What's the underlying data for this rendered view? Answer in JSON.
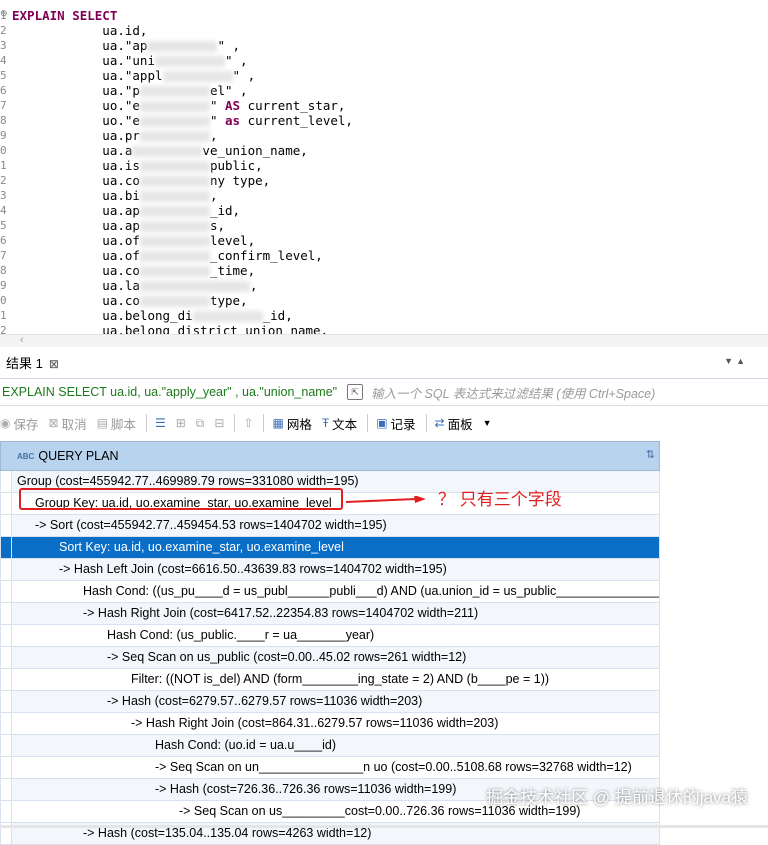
{
  "editor": {
    "lines": [
      {
        "num": "1",
        "parts": [
          {
            "t": "EXPLAIN SELECT",
            "c": "kw"
          }
        ]
      },
      {
        "num": "2",
        "parts": [
          {
            "t": "            ua.id,"
          }
        ]
      },
      {
        "num": "3",
        "parts": [
          {
            "t": "            ua.\"ap"
          },
          {
            "blur": true
          },
          {
            "t": "\" ,"
          }
        ]
      },
      {
        "num": "4",
        "parts": [
          {
            "t": "            ua.\"uni"
          },
          {
            "blur": true
          },
          {
            "t": "\" ,"
          }
        ]
      },
      {
        "num": "5",
        "parts": [
          {
            "t": "            ua.\"appl"
          },
          {
            "blur": true
          },
          {
            "t": "\" ,"
          }
        ]
      },
      {
        "num": "6",
        "parts": [
          {
            "t": "            ua.\"p"
          },
          {
            "blur": true
          },
          {
            "t": "el\" ,"
          }
        ]
      },
      {
        "num": "7",
        "parts": [
          {
            "t": "            uo.\"e"
          },
          {
            "blur": true
          },
          {
            "t": "\" "
          },
          {
            "t": "AS",
            "c": "kw"
          },
          {
            "t": " current_star,"
          }
        ]
      },
      {
        "num": "8",
        "parts": [
          {
            "t": "            uo.\"e"
          },
          {
            "blur": true
          },
          {
            "t": "\" "
          },
          {
            "t": "as",
            "c": "kw"
          },
          {
            "t": " current_level,"
          }
        ]
      },
      {
        "num": "9",
        "parts": [
          {
            "t": "            ua.pr"
          },
          {
            "blur": true
          },
          {
            "t": ","
          }
        ]
      },
      {
        "num": "0",
        "parts": [
          {
            "t": "            ua.a"
          },
          {
            "blur": true
          },
          {
            "t": "ve_union_name,"
          }
        ]
      },
      {
        "num": "1",
        "parts": [
          {
            "t": "            ua.is"
          },
          {
            "blur": true
          },
          {
            "t": "public,"
          }
        ]
      },
      {
        "num": "2",
        "parts": [
          {
            "t": "            ua.co"
          },
          {
            "blur": true
          },
          {
            "t": "ny type,"
          }
        ]
      },
      {
        "num": "3",
        "parts": [
          {
            "t": "            ua.bi"
          },
          {
            "blur": true
          },
          {
            "t": ","
          }
        ]
      },
      {
        "num": "4",
        "parts": [
          {
            "t": "            ua.ap"
          },
          {
            "blur": true
          },
          {
            "t": "_id,"
          }
        ]
      },
      {
        "num": "5",
        "parts": [
          {
            "t": "            ua.ap"
          },
          {
            "blur": true
          },
          {
            "t": "s,"
          }
        ]
      },
      {
        "num": "6",
        "parts": [
          {
            "t": "            ua.of"
          },
          {
            "blur": true
          },
          {
            "t": "level,"
          }
        ]
      },
      {
        "num": "7",
        "parts": [
          {
            "t": "            ua.of"
          },
          {
            "blur": true
          },
          {
            "t": "_confirm_level,"
          }
        ]
      },
      {
        "num": "8",
        "parts": [
          {
            "t": "            ua.co"
          },
          {
            "blur": true
          },
          {
            "t": "_time,"
          }
        ]
      },
      {
        "num": "9",
        "parts": [
          {
            "t": "            ua.la"
          },
          {
            "blur": true,
            "wide": true
          },
          {
            "t": ","
          }
        ]
      },
      {
        "num": "0",
        "parts": [
          {
            "t": "            ua.co"
          },
          {
            "blur": true
          },
          {
            "t": "type,"
          }
        ]
      },
      {
        "num": "1",
        "parts": [
          {
            "t": "            ua.belong_di"
          },
          {
            "blur": true
          },
          {
            "t": "_id,"
          }
        ]
      },
      {
        "num": "2",
        "parts": [
          {
            "t": "            ua.belong_district_union_name,"
          }
        ]
      }
    ]
  },
  "results_tab": {
    "label": "结果 1",
    "close": "⊠"
  },
  "filter_bar": {
    "query": "EXPLAIN SELECT ua.id, ua.\"apply_year\" , ua.\"union_name\"",
    "placeholder": "输入一个 SQL 表达式来过滤结果 (使用 Ctrl+Space)"
  },
  "toolbar": {
    "save": "保存",
    "cancel": "取消",
    "script": "脚本",
    "grid": "网格",
    "text": "文本",
    "record": "记录",
    "panel": "面板"
  },
  "grid": {
    "column_type": "ABC",
    "column_header": "QUERY PLAN",
    "rows": [
      {
        "text": "Group  (cost=455942.77..469989.79 rows=331080 width=195)"
      },
      {
        "text": "Group Key: ua.id, uo.examine_star, uo.examine_level"
      },
      {
        "text": "->  Sort  (cost=455942.77..459454.53 rows=1404702 width=195)"
      },
      {
        "text": "Sort Key: ua.id, uo.examine_star, uo.examine_level"
      },
      {
        "text": "->  Hash Left Join  (cost=6616.50..43639.83 rows=1404702 width=195)"
      },
      {
        "text": "Hash Cond: ((us_pu____d = us_publ______publi___d) AND (ua.union_id = us_public_______________id))"
      },
      {
        "text": "->  Hash Right Join  (cost=6417.52..22354.83 rows=1404702 width=211)"
      },
      {
        "text": "Hash Cond: (us_public.____r = ua_______year)"
      },
      {
        "text": "->  Seq Scan on us_public  (cost=0.00..45.02 rows=261 width=12)"
      },
      {
        "text": "Filter: ((NOT is_del) AND (form________ing_state = 2) AND (b____pe = 1))"
      },
      {
        "text": "->  Hash  (cost=6279.57..6279.57 rows=11036 width=203)"
      },
      {
        "text": "->  Hash Right Join  (cost=864.31..6279.57 rows=11036 width=203)"
      },
      {
        "text": "Hash Cond: (uo.id = ua.u____id)"
      },
      {
        "text": "->  Seq Scan on un_______________n uo  (cost=0.00..5108.68 rows=32768 width=12)"
      },
      {
        "text": "->  Hash  (cost=726.36..726.36 rows=11036 width=199)"
      },
      {
        "text": "->  Seq Scan on us_________cost=0.00..726.36 rows=11036 width=199)"
      },
      {
        "text": "->  Hash  (cost=135.04..135.04 rows=4263 width=12)"
      }
    ]
  },
  "annotation": {
    "note": "？ 只有三个字段"
  },
  "watermark": "掘金技术社区 @ 提前退休的java猿"
}
